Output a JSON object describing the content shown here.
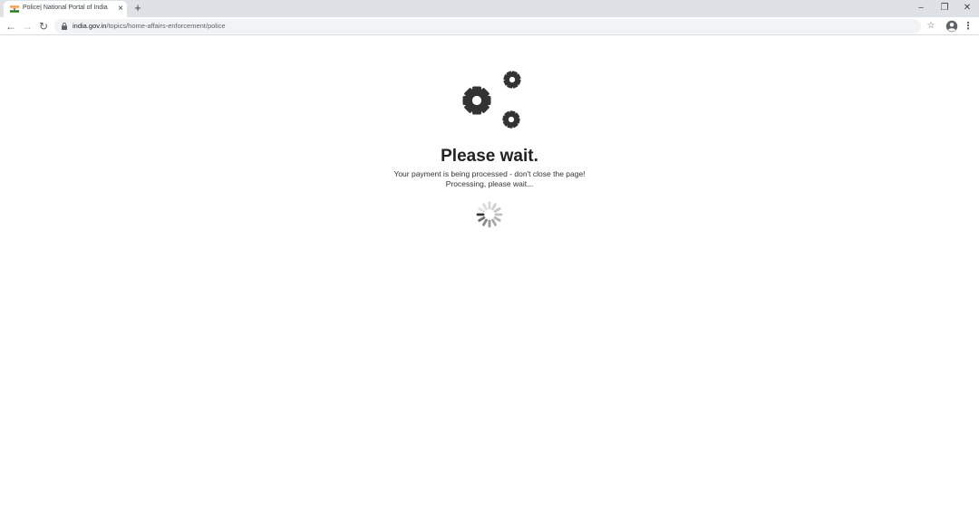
{
  "browser": {
    "tab": {
      "title": "Police| National Portal of India",
      "close_icon": "×"
    },
    "new_tab_icon": "+",
    "window_controls": {
      "minimize": "–",
      "restore": "❐",
      "close": "✕"
    },
    "nav": {
      "back": "←",
      "forward": "→",
      "reload": "↻"
    },
    "url": {
      "host": "india.gov.in",
      "path": "/topics/home-affairs-enforcement/police"
    },
    "bookmark_icon": "☆",
    "menu_icon": "⋮"
  },
  "page": {
    "heading": "Please wait.",
    "message": "Your payment is being processed - don't close the page!",
    "status": "Processing, please wait...",
    "icons": [
      "gears-icon",
      "loading-spinner-icon"
    ]
  },
  "colors": {
    "gear": "#333333",
    "heading": "#222222",
    "tab_strip": "#dee1e6",
    "omnibox": "#f1f3f4",
    "flag_saffron": "#ff9933",
    "flag_green": "#138808"
  }
}
